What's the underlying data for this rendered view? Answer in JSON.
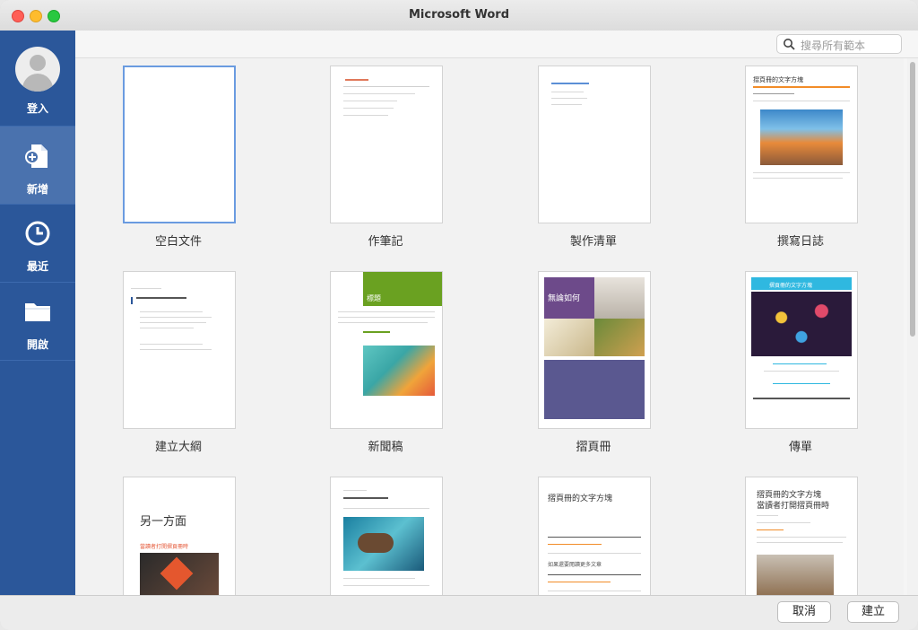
{
  "window": {
    "title": "Microsoft Word"
  },
  "sidebar": {
    "items": [
      {
        "label": "登入",
        "icon": "account-avatar-icon"
      },
      {
        "label": "新增",
        "icon": "new-document-icon"
      },
      {
        "label": "最近",
        "icon": "clock-icon"
      },
      {
        "label": "開啟",
        "icon": "folder-icon"
      }
    ]
  },
  "search": {
    "placeholder": "搜尋所有範本"
  },
  "templates": [
    {
      "name": "空白文件"
    },
    {
      "name": "作筆記"
    },
    {
      "name": "製作清單"
    },
    {
      "name": "撰寫日誌"
    },
    {
      "name": "建立大綱"
    },
    {
      "name": "新聞稿"
    },
    {
      "name": "摺頁冊"
    },
    {
      "name": "傳單"
    }
  ],
  "thumb_text": {
    "brochure_head": "無論如何",
    "newsletter_head": "標題",
    "aside_head": "另一方面",
    "aside_sub": "當讀者打開摺頁冊時",
    "brochure3_title": "摺頁冊的文字方塊",
    "brochure3_sub": "如果還要閱讀更多文章",
    "brochure4_title": "摺頁冊的文字方塊",
    "brochure4_sub": "當讀者打開摺頁冊時",
    "journal_title": "摺頁冊的文字方塊",
    "flyer_title": "摺頁冊的文字方塊"
  },
  "footer": {
    "cancel_label": "取消",
    "create_label": "建立"
  },
  "colors": {
    "sidebar": "#2b579a",
    "sidebar_active": "#4a72ae",
    "accent_green": "#6aa121",
    "accent_purple": "#6d4a8a",
    "accent_orange": "#f28c28",
    "accent_cyan": "#2fb8e0"
  }
}
